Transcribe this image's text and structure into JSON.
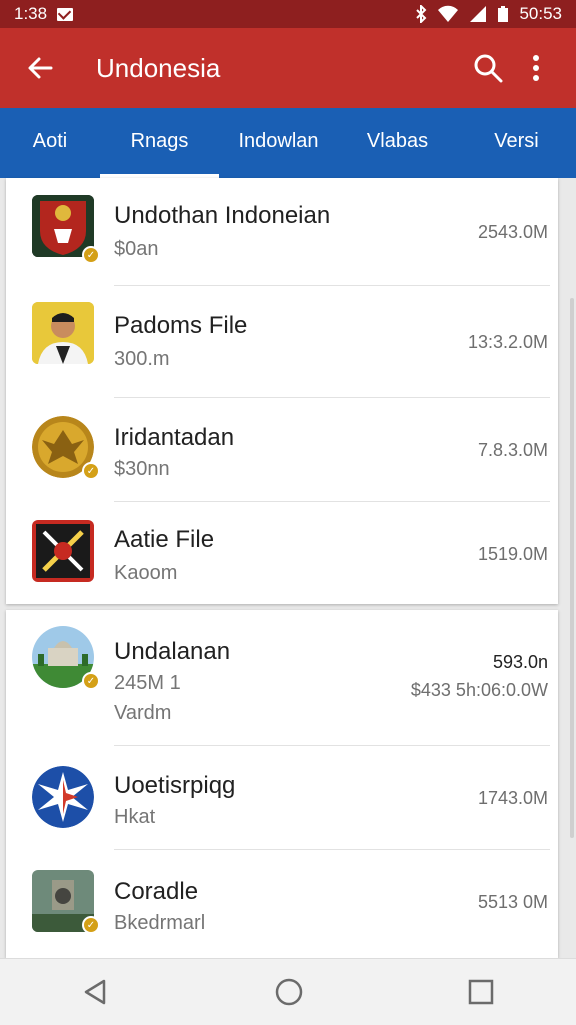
{
  "status_bar": {
    "time": "1:38",
    "clock": "50:53"
  },
  "app_bar": {
    "title": "Undonesia"
  },
  "tabs": [
    {
      "label": "Aoti",
      "active": false
    },
    {
      "label": "Rnags",
      "active": true
    },
    {
      "label": "Indowlan",
      "active": false
    },
    {
      "label": "Vlabas",
      "active": false
    },
    {
      "label": "Versi",
      "active": false
    }
  ],
  "items": [
    {
      "name": "Undothan Indoneian",
      "sub": "$0an",
      "size": "2543.0M"
    },
    {
      "name": "Padoms File",
      "sub": "300.m",
      "size": "13:3.2.0M"
    },
    {
      "name": "Iridantadan",
      "sub": "$30nn",
      "size": "7.8.3.0M"
    },
    {
      "name": "Aatie File",
      "sub": "Kaoom",
      "size": "1519.0M"
    },
    {
      "name": "Undalanan",
      "sub": "245M 1",
      "sub2": "Vardm",
      "size": "593.0n",
      "extra": "$433 5h:06:0.0W"
    },
    {
      "name": "Uoetisrpiqg",
      "sub": "Hkat",
      "size": "1743.0M"
    },
    {
      "name": "Coradle",
      "sub": "Bkedrmarl",
      "size": "5513 0M"
    }
  ],
  "colors": {
    "status": "#8e1f1f",
    "appbar": "#c0302b",
    "tabs": "#1a5fb4"
  }
}
